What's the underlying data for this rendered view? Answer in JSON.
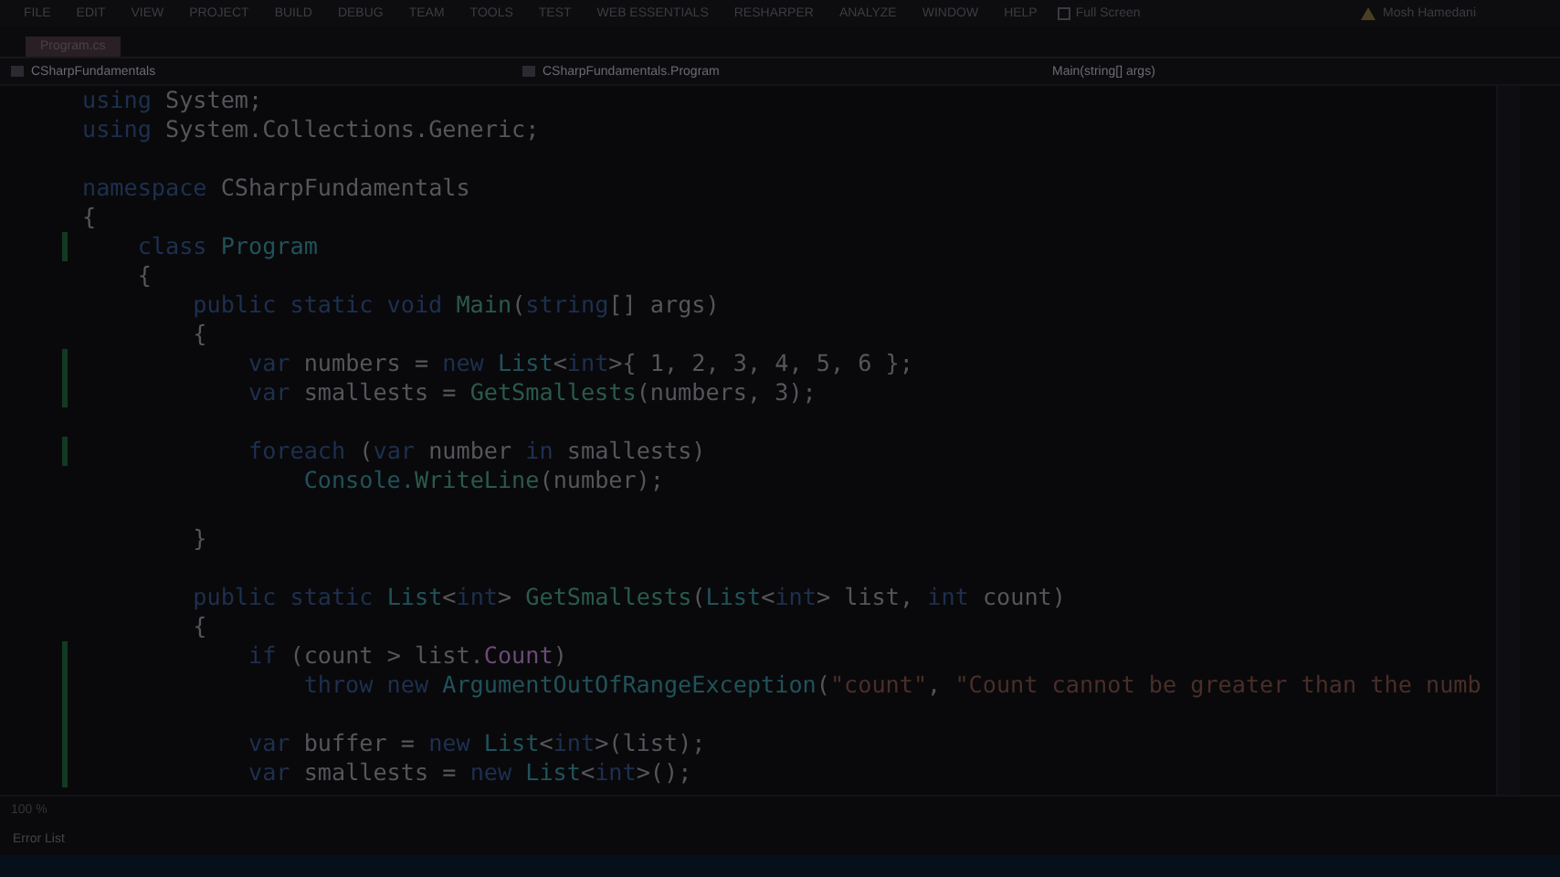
{
  "menu_bar": {
    "items": [
      "FILE",
      "EDIT",
      "VIEW",
      "PROJECT",
      "BUILD",
      "DEBUG",
      "TEAM",
      "TOOLS",
      "TEST",
      "WEB ESSENTIALS",
      "RESHARPER",
      "ANALYZE",
      "WINDOW",
      "HELP"
    ],
    "full_screen": "Full Screen",
    "user": "Mosh Hamedani"
  },
  "tabs": [
    {
      "label": "Program.cs",
      "selected": true
    }
  ],
  "nav_bar": {
    "project": "CSharpFundamentals",
    "type": "CSharpFundamentals.Program",
    "member": "Main(string[] args)"
  },
  "editor": {
    "lines": [
      {
        "kind": "code",
        "tokens": [
          {
            "kind": "keyword",
            "text": "using"
          },
          {
            "kind": "plain",
            "text": " System;"
          }
        ]
      },
      {
        "kind": "code",
        "tokens": [
          {
            "kind": "keyword",
            "text": "using"
          },
          {
            "kind": "plain",
            "text": " System.Collections.Generic;"
          }
        ]
      },
      {
        "kind": "blank"
      },
      {
        "kind": "code",
        "tokens": [
          {
            "kind": "keyword",
            "text": "namespace"
          },
          {
            "kind": "plain",
            "text": " CSharpFundamentals"
          }
        ]
      },
      {
        "kind": "code",
        "tokens": [
          {
            "kind": "plain",
            "text": "{"
          }
        ]
      },
      {
        "kind": "code",
        "tokens": [
          {
            "kind": "keyword",
            "text": "    class"
          },
          {
            "kind": "type",
            "text": " Program"
          }
        ]
      },
      {
        "kind": "code",
        "tokens": [
          {
            "kind": "plain",
            "text": "    {"
          }
        ]
      },
      {
        "kind": "code",
        "tokens": [
          {
            "kind": "keyword",
            "text": "        public static void"
          },
          {
            "kind": "method",
            "text": " Main"
          },
          {
            "kind": "plain",
            "text": "("
          },
          {
            "kind": "keyword",
            "text": "string"
          },
          {
            "kind": "plain",
            "text": "[] args)"
          }
        ]
      },
      {
        "kind": "code",
        "tokens": [
          {
            "kind": "plain",
            "text": "        {"
          }
        ]
      },
      {
        "kind": "code",
        "tokens": [
          {
            "kind": "keyword",
            "text": "            var"
          },
          {
            "kind": "plain",
            "text": " numbers = "
          },
          {
            "kind": "keyword",
            "text": "new"
          },
          {
            "kind": "type",
            "text": " List"
          },
          {
            "kind": "plain",
            "text": "<"
          },
          {
            "kind": "keyword",
            "text": "int"
          },
          {
            "kind": "plain",
            "text": ">{ 1, 2, 3, 4, 5, 6 };"
          }
        ]
      },
      {
        "kind": "code",
        "tokens": [
          {
            "kind": "keyword",
            "text": "            var"
          },
          {
            "kind": "plain",
            "text": " smallests = "
          },
          {
            "kind": "method",
            "text": "GetSmallests"
          },
          {
            "kind": "plain",
            "text": "(numbers, 3);"
          }
        ]
      },
      {
        "kind": "blank"
      },
      {
        "kind": "code",
        "tokens": [
          {
            "kind": "keyword",
            "text": "            foreach"
          },
          {
            "kind": "plain",
            "text": " ("
          },
          {
            "kind": "keyword",
            "text": "var"
          },
          {
            "kind": "plain",
            "text": " number "
          },
          {
            "kind": "keyword",
            "text": "in"
          },
          {
            "kind": "plain",
            "text": " smallests)"
          }
        ]
      },
      {
        "kind": "code",
        "tokens": [
          {
            "kind": "type",
            "text": "                Console."
          },
          {
            "kind": "method",
            "text": "WriteLine"
          },
          {
            "kind": "plain",
            "text": "(number);"
          }
        ]
      },
      {
        "kind": "blank"
      },
      {
        "kind": "code",
        "tokens": [
          {
            "kind": "plain",
            "text": "        }"
          }
        ]
      },
      {
        "kind": "blank"
      },
      {
        "kind": "code",
        "tokens": [
          {
            "kind": "keyword",
            "text": "        public static"
          },
          {
            "kind": "type",
            "text": " List"
          },
          {
            "kind": "plain",
            "text": "<"
          },
          {
            "kind": "keyword",
            "text": "int"
          },
          {
            "kind": "plain",
            "text": "> "
          },
          {
            "kind": "method",
            "text": "GetSmallests"
          },
          {
            "kind": "plain",
            "text": "("
          },
          {
            "kind": "type",
            "text": "List"
          },
          {
            "kind": "plain",
            "text": "<"
          },
          {
            "kind": "keyword",
            "text": "int"
          },
          {
            "kind": "plain",
            "text": "> list, "
          },
          {
            "kind": "keyword",
            "text": "int"
          },
          {
            "kind": "plain",
            "text": " count)"
          }
        ]
      },
      {
        "kind": "code",
        "tokens": [
          {
            "kind": "plain",
            "text": "        {"
          }
        ]
      },
      {
        "kind": "code",
        "tokens": [
          {
            "kind": "keyword",
            "text": "            if"
          },
          {
            "kind": "plain",
            "text": " (count > list."
          },
          {
            "kind": "property",
            "text": "Count"
          },
          {
            "kind": "plain",
            "text": ")"
          }
        ]
      },
      {
        "kind": "code",
        "tokens": [
          {
            "kind": "keyword",
            "text": "                throw new"
          },
          {
            "kind": "type",
            "text": " ArgumentOutOfRangeException"
          },
          {
            "kind": "plain",
            "text": "("
          },
          {
            "kind": "string",
            "text": "\"count\""
          },
          {
            "kind": "plain",
            "text": ", "
          },
          {
            "kind": "string",
            "text": "\"Count cannot be greater than the numb"
          }
        ]
      },
      {
        "kind": "blank"
      },
      {
        "kind": "code",
        "tokens": [
          {
            "kind": "keyword",
            "text": "            var"
          },
          {
            "kind": "plain",
            "text": " buffer = "
          },
          {
            "kind": "keyword",
            "text": "new"
          },
          {
            "kind": "type",
            "text": " List"
          },
          {
            "kind": "plain",
            "text": "<"
          },
          {
            "kind": "keyword",
            "text": "int"
          },
          {
            "kind": "plain",
            "text": ">(list);"
          }
        ]
      },
      {
        "kind": "code",
        "tokens": [
          {
            "kind": "keyword",
            "text": "            var"
          },
          {
            "kind": "plain",
            "text": " smallests = "
          },
          {
            "kind": "keyword",
            "text": "new"
          },
          {
            "kind": "type",
            "text": " List"
          },
          {
            "kind": "plain",
            "text": "<"
          },
          {
            "kind": "keyword",
            "text": "int"
          },
          {
            "kind": "plain",
            "text": ">();"
          }
        ]
      }
    ]
  },
  "status_bar": {
    "zoom": "100 %"
  },
  "bottom_tabs": [
    {
      "label": "Error List",
      "selected": true
    }
  ]
}
